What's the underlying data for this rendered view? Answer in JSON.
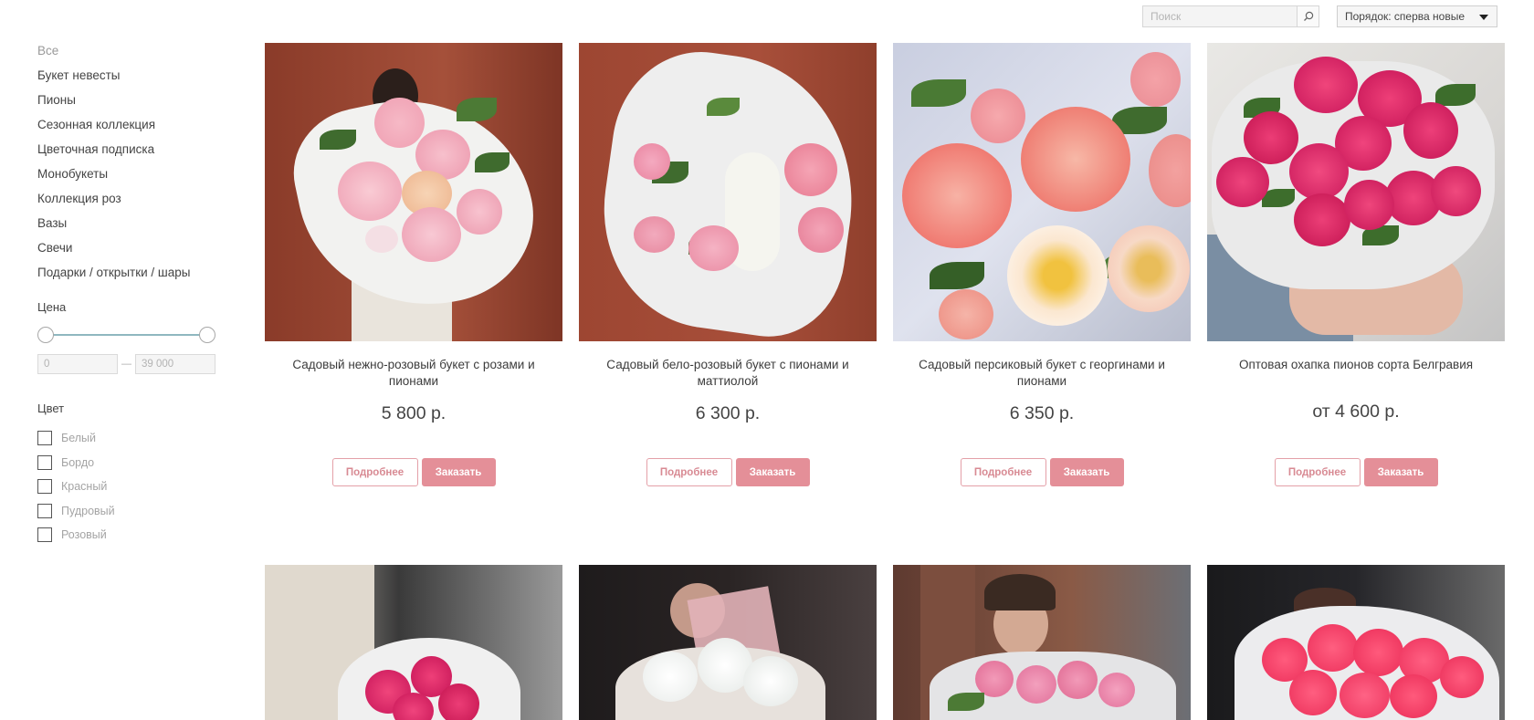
{
  "search": {
    "placeholder": "Поиск",
    "icon": "search-icon"
  },
  "sort": {
    "label": "Порядок: сперва новые"
  },
  "sidebar": {
    "categories": [
      "Все",
      "Букет невесты",
      "Пионы",
      "Сезонная коллекция",
      "Цветочная подписка",
      "Монобукеты",
      "Коллекция роз",
      "Вазы",
      "Свечи",
      "Подарки / открытки / шары"
    ],
    "price_filter": {
      "title": "Цена",
      "min_placeholder": "0",
      "max_placeholder": "39 000",
      "separator": "—"
    },
    "color_filter": {
      "title": "Цвет",
      "options": [
        "Белый",
        "Бордо",
        "Красный",
        "Пудровый",
        "Розовый"
      ]
    }
  },
  "products": [
    {
      "title": "Садовый нежно-розовый букет с розами и пионами",
      "price": "5 800 р.",
      "more_label": "Подробнее",
      "order_label": "Заказать"
    },
    {
      "title": "Садовый бело-розовый букет с пионами и маттиолой",
      "price": "6 300 р.",
      "more_label": "Подробнее",
      "order_label": "Заказать"
    },
    {
      "title": "Садовый персиковый букет с георгинами и пионами",
      "price": "6 350 р.",
      "more_label": "Подробнее",
      "order_label": "Заказать"
    },
    {
      "title": "Оптовая охапка пионов сорта Белгравия",
      "price": "от 4 600 р.",
      "more_label": "Подробнее",
      "order_label": "Заказать"
    }
  ],
  "colors": {
    "accent": "#e48f98",
    "accent_border": "#e4a0a8",
    "slider_track": "#8fb7bf"
  }
}
